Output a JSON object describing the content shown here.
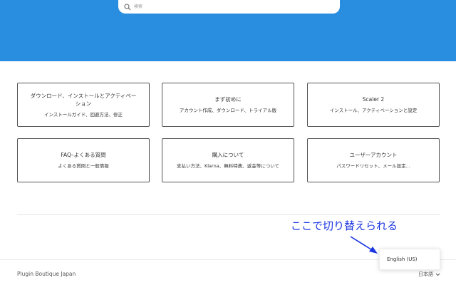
{
  "search": {
    "placeholder": "検索"
  },
  "cards": [
    {
      "title": "ダウンロード、インストールとアクティベーション",
      "subtitle": "インストールガイド、回避方法、修正"
    },
    {
      "title": "まず初めに",
      "subtitle": "アカウント作成、ダウンロード、トライアル版"
    },
    {
      "title": "Scaler 2",
      "subtitle": "インストール、アクティベーションと設定"
    },
    {
      "title": "FAQ–よくある質問",
      "subtitle": "よくある質問と一般情報"
    },
    {
      "title": "購入について",
      "subtitle": "支払い方法、Klarna、無料特典、返金等について"
    },
    {
      "title": "ユーザーアカウント",
      "subtitle": "パスワードリセット、メール設定..."
    }
  ],
  "annotation": {
    "text": "ここで切り替えられる",
    "color": "#1a35e0"
  },
  "language_popup": {
    "option": "English (US)"
  },
  "footer": {
    "brand": "Plugin Boutique Japan",
    "language": "日本語"
  },
  "colors": {
    "hero": "#2a8ee0"
  }
}
